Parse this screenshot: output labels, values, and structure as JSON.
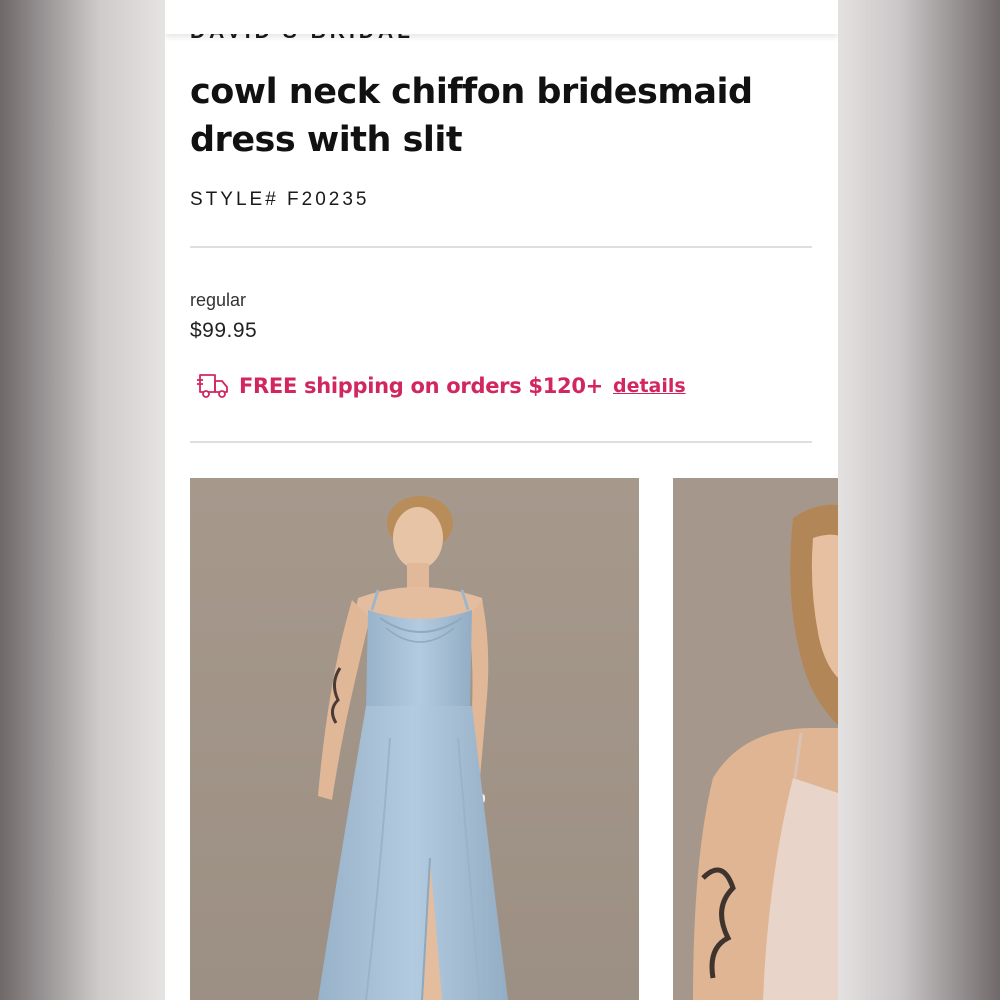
{
  "brand": "DAVID'S BRIDAL",
  "product": {
    "title": "cowl neck chiffon bridesmaid dress with slit",
    "style_number": "STYLE# F20235",
    "price_label": "regular",
    "price": "$99.95"
  },
  "shipping": {
    "icon": "delivery-truck-icon",
    "text": "FREE shipping on orders $120+",
    "link_label": "details"
  },
  "colors": {
    "accent": "#d1275e",
    "dress": "#a9c3da",
    "backdrop": "#a4978a"
  },
  "gallery": [
    {
      "alt": "model wearing light blue cowl neck chiffon dress"
    },
    {
      "alt": "close-up of model in blush cowl neck dress"
    }
  ]
}
